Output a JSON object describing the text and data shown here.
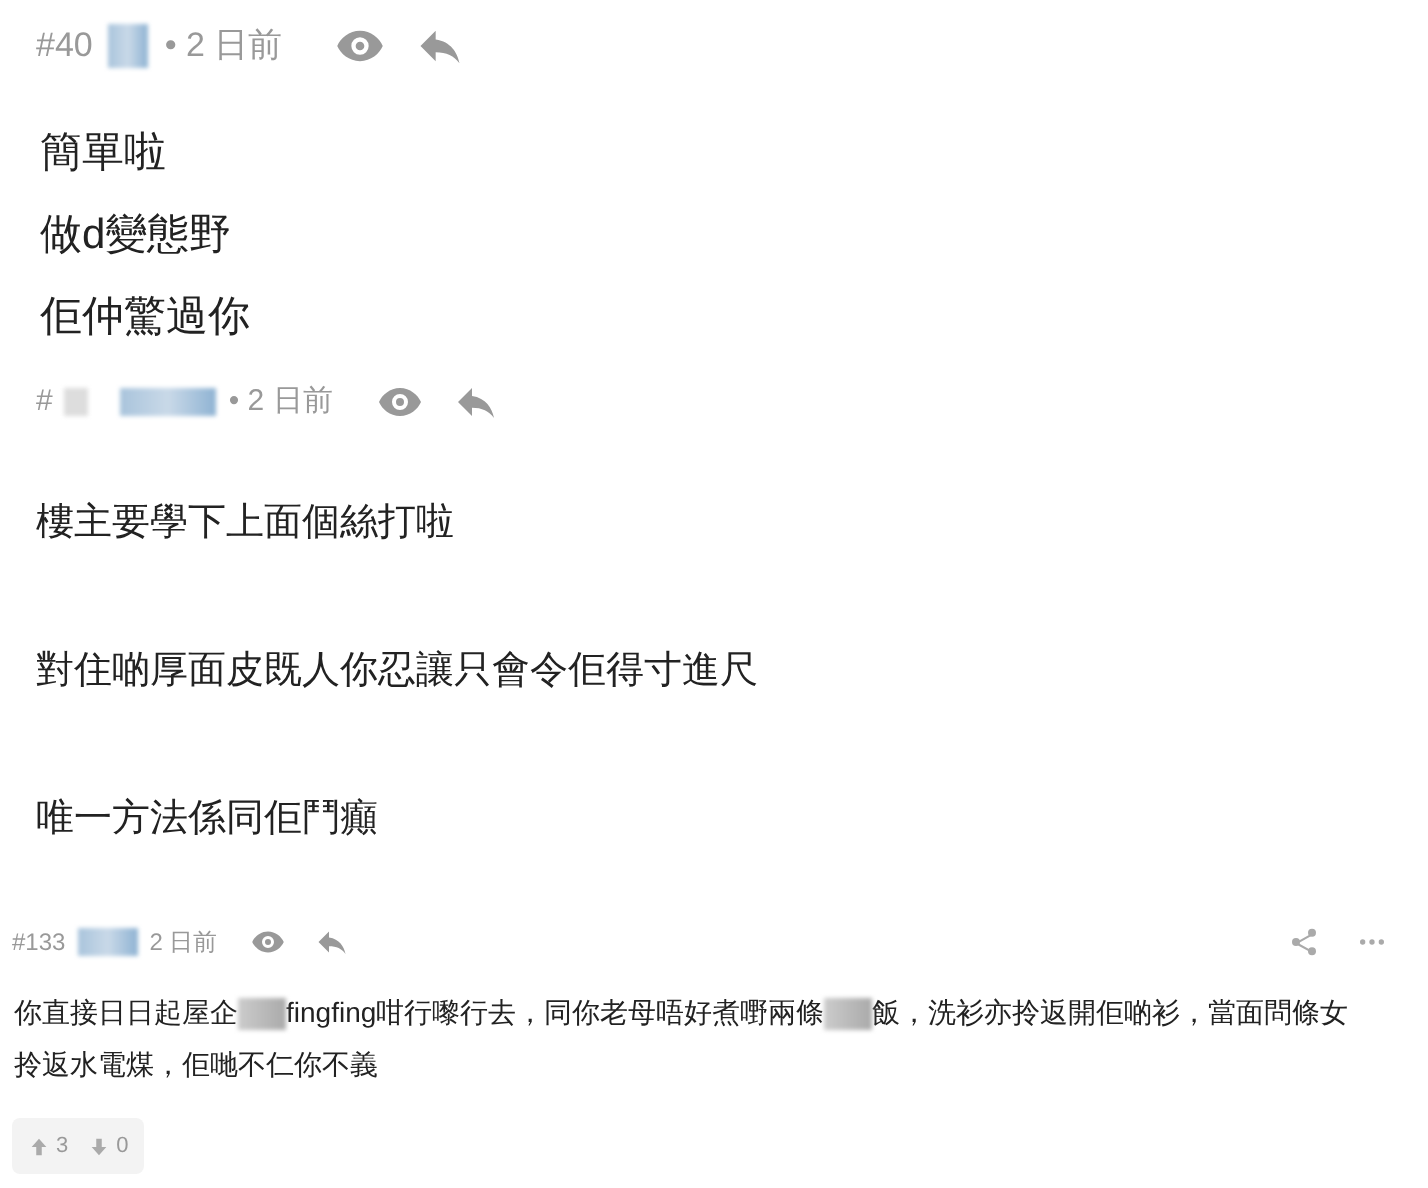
{
  "posts": [
    {
      "kind": "large",
      "number": "#40",
      "time": "• 2 日前",
      "paragraphs": [
        [
          {
            "text": "簡單啦"
          }
        ],
        [
          {
            "text": "做d變態野"
          }
        ],
        [
          {
            "text": "佢仲驚過你"
          }
        ]
      ]
    },
    {
      "kind": "medium",
      "number": "#",
      "time": "• 2 日前",
      "paragraphs": [
        [
          {
            "text": "樓主要學下上面個絲打啦"
          }
        ],
        [
          {
            "text": "對住啲厚面皮既人你忍讓只會令佢得寸進尺"
          }
        ],
        [
          {
            "text": "唯一方法係同佢鬥癲"
          }
        ]
      ]
    },
    {
      "kind": "compact",
      "number": "#133",
      "time": "2 日前",
      "paragraphs": [
        [
          {
            "text": "你直接日日起屋企"
          },
          {
            "kind": "redacted"
          },
          {
            "text": "fingfing咁行嚟行去，同你老母唔好煮嘢兩條"
          },
          {
            "kind": "redacted"
          },
          {
            "text": "飯，洗衫亦拎返開佢啲衫，當面問條女拎返水電煤，佢哋不仁你不義"
          }
        ]
      ],
      "upvotes": "3",
      "downvotes": "0"
    }
  ]
}
